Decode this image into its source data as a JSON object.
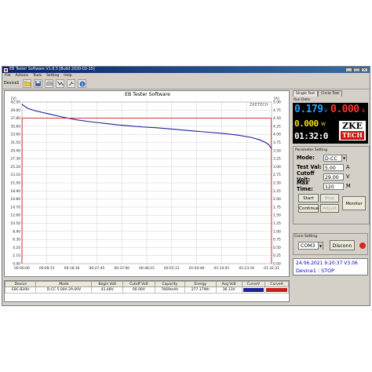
{
  "window": {
    "title": "EB Tester Software V1.8.5 [Build 2020-02-15]",
    "controls": [
      "_",
      "□",
      "×"
    ]
  },
  "menu": [
    "File",
    "Actions",
    "Tools",
    "Setting",
    "Help"
  ],
  "toolbar": {
    "device_label": "Device1",
    "buttons": [
      "open-icon",
      "save-icon",
      "print-icon",
      "curve-icon",
      "tools-icon",
      "info-icon"
    ]
  },
  "chart": {
    "title": "EB Tester Software",
    "brand": "ZKETECH",
    "left_unit": "[V]",
    "right_unit": "[A]"
  },
  "chart_data": {
    "type": "line",
    "title": "EB Tester Software",
    "x_ticks": [
      "00:00:00",
      "00:09:15",
      "00:18:30",
      "00:27:45",
      "00:37:00",
      "00:46:15",
      "00:55:31",
      "01:04:46",
      "01:14:01",
      "01:23:16",
      "01:32:31"
    ],
    "y_left_ticks": [
      "42.00",
      "39.60",
      "37.80",
      "35.60",
      "33.60",
      "31.50",
      "29.40",
      "27.30",
      "25.20",
      "23.10",
      "21.00",
      "18.90",
      "16.80",
      "14.70",
      "12.60",
      "10.50",
      "8.40",
      "6.30",
      "4.20",
      "2.10",
      "0.00"
    ],
    "y_right_ticks": [
      "5.00",
      "4.75",
      "4.50",
      "4.25",
      "4.00",
      "3.75",
      "3.50",
      "3.25",
      "3.00",
      "2.75",
      "2.50",
      "2.25",
      "2.00",
      "1.75",
      "1.50",
      "1.25",
      "1.00",
      "0.75",
      "0.50",
      "0.25",
      "0.00"
    ],
    "ylim_left": [
      0,
      42
    ],
    "ylim_right": [
      0,
      5
    ],
    "xlim_minutes": [
      0,
      92.5
    ],
    "grid": true,
    "series": [
      {
        "color": "#1f1f9a",
        "axis": "left",
        "x_minutes": [
          0,
          2,
          5,
          10,
          15,
          20,
          25,
          30,
          35,
          40,
          45,
          50,
          55,
          60,
          65,
          70,
          75,
          80,
          85,
          88,
          90,
          91.5,
          92.5
        ],
        "y": [
          41.4,
          40.4,
          39.7,
          38.9,
          38.1,
          37.4,
          36.9,
          36.5,
          36.1,
          35.8,
          35.5,
          35.3,
          35.0,
          34.7,
          34.4,
          34.1,
          33.8,
          33.4,
          32.8,
          32.2,
          31.6,
          30.9,
          29.8
        ]
      },
      {
        "color": "#c81e1e",
        "axis": "right",
        "x_minutes": [
          0,
          0.05,
          92.4,
          92.5
        ],
        "y": [
          0,
          4.5,
          4.5,
          0
        ]
      }
    ]
  },
  "table": {
    "headers": [
      "Device",
      "Mode",
      "Begin Volt",
      "Cutoff Volt",
      "Capacity",
      "Energy",
      "Avg Volt",
      "CurveV",
      "CurveA"
    ],
    "rows": [
      {
        "device": "EBC-B20H",
        "mode": "D-CC 5.00A 29.00V",
        "begin_volt": "41.48V",
        "cutoff_volt": "00.00V",
        "capacity": "7669mAh",
        "energy": "277.17Wh",
        "avg_volt": "36.13V",
        "curve_v_color": "#1f1f9a",
        "curve_a_color": "#c81e1e"
      }
    ]
  },
  "right_panel": {
    "tabs": [
      "Single Test",
      "Circle Test"
    ],
    "run_data_label": "Run Data",
    "voltage": "0.179",
    "voltage_unit": "V",
    "current": "0.000",
    "current_unit": "A",
    "power": "0.000",
    "power_unit": "W",
    "time": "01:32:0",
    "logo_top": "ZKE",
    "logo_bottom": "TECH",
    "parameter_label": "Parameter Setting",
    "params": {
      "mode_label": "Mode:",
      "mode_value": "D-CC",
      "test_val_label": "Test Val:",
      "test_val_value": "5.00",
      "test_val_unit": "A",
      "cutoff_label": "Cutoff Volt:",
      "cutoff_value": "29.00",
      "cutoff_unit": "V",
      "max_time_label": "Max Time:",
      "max_time_value": "120",
      "max_time_unit": "M"
    },
    "buttons": {
      "start": "Start",
      "stop": "Stop",
      "continue": "Continue",
      "adjust": "Adjust",
      "monitor": "Monitor"
    },
    "conn_label": "Conn Setting",
    "com_port": "COM3",
    "disconnect": "Disconn",
    "status_datetime": "24.06.2021  9:20:37  V3.06",
    "status_device": "Device1 : STOP"
  }
}
